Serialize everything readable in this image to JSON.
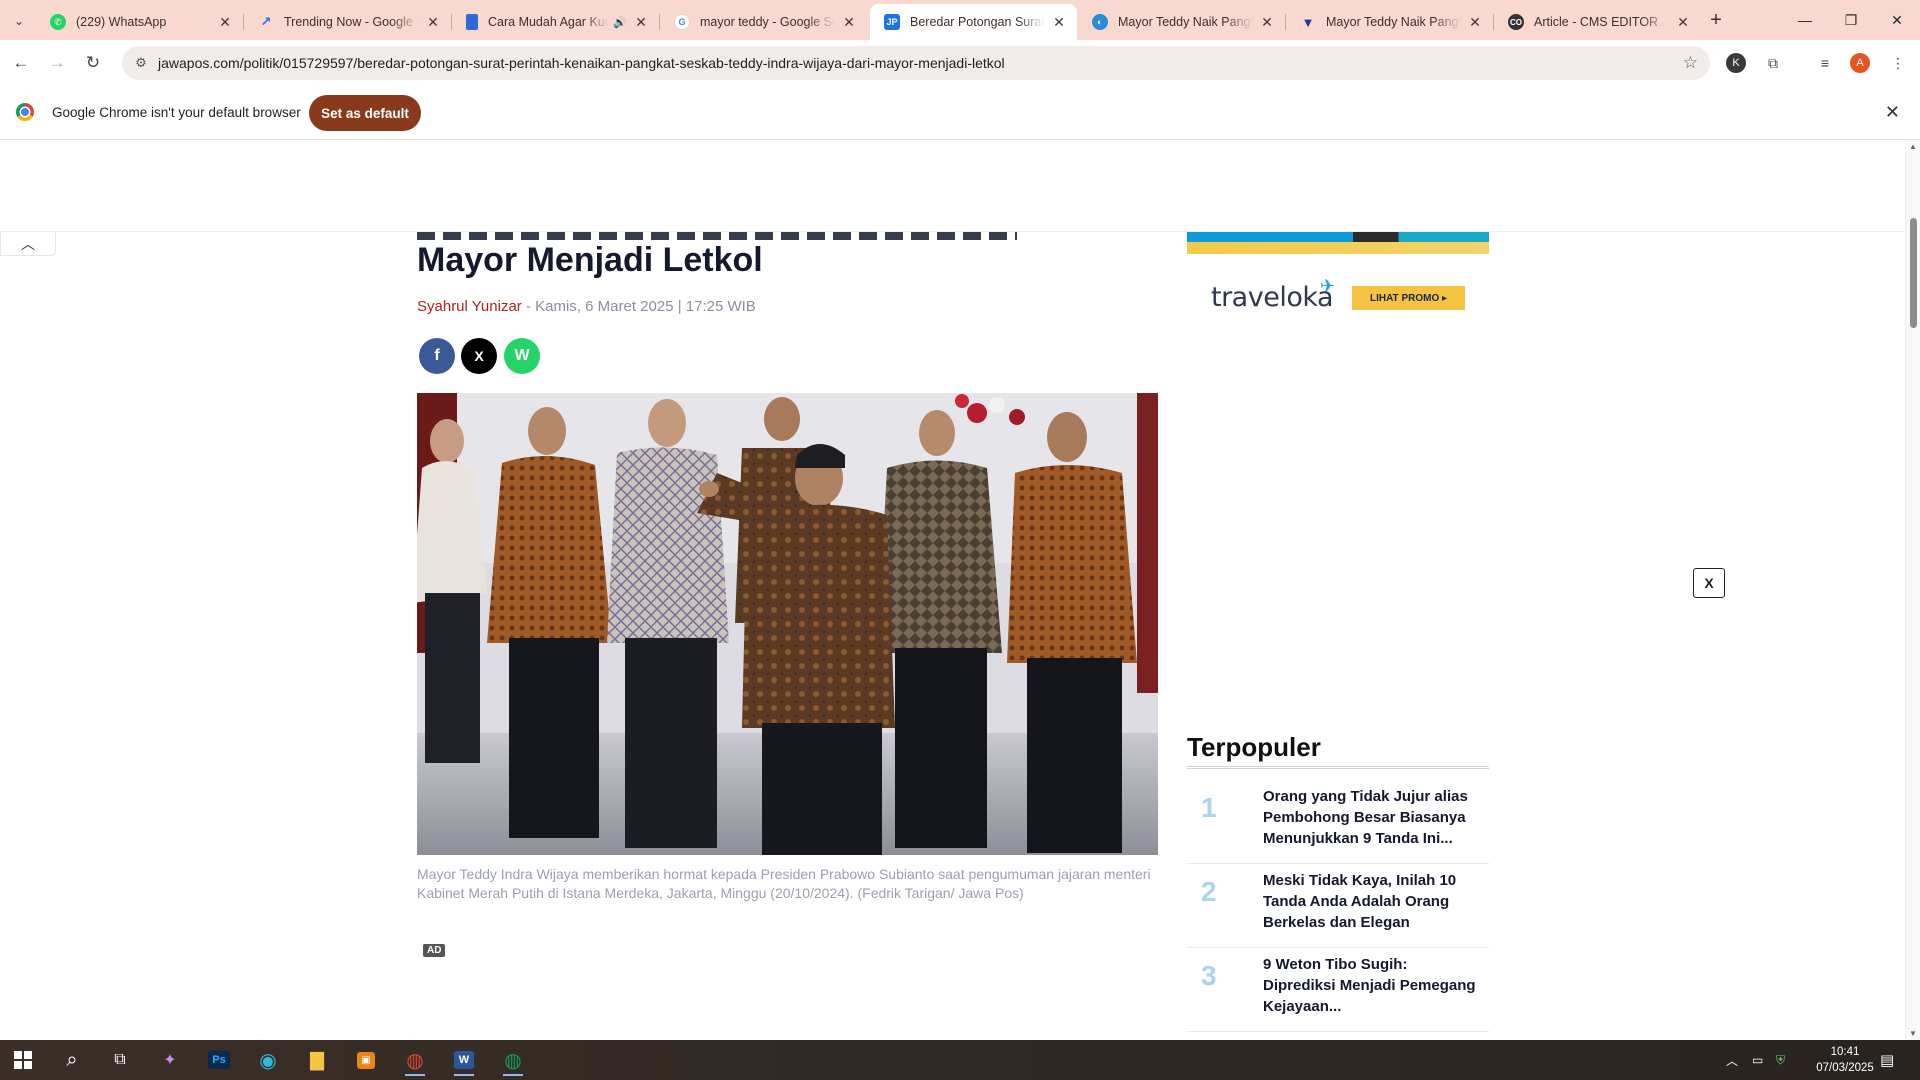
{
  "browser": {
    "tabs": [
      {
        "title": "(229) WhatsApp",
        "icon": "whatsapp-icon",
        "color": "#25d366"
      },
      {
        "title": "Trending Now - Google Trends",
        "icon": "trends-icon",
        "color": "#4285f4"
      },
      {
        "title": "Cara Mudah Agar Kucing",
        "icon": "page-icon",
        "color": "#2f6bd6"
      },
      {
        "title": "mayor teddy - Google Search",
        "icon": "google-icon",
        "color": "#4285f4"
      },
      {
        "title": "Beredar Potongan Surat Perintah",
        "icon": "jawapos-icon",
        "color": "#1a73e8"
      },
      {
        "title": "Mayor Teddy Naik Pangkat",
        "icon": "site-icon",
        "color": "#2a8bd8"
      },
      {
        "title": "Mayor Teddy Naik Pangkat",
        "icon": "site-icon-2",
        "color": "#1a3d8f"
      },
      {
        "title": "Article - CMS EDITOR",
        "icon": "cms-icon",
        "color": "#333333"
      }
    ],
    "url": "jawapos.com/politik/015729597/beredar-potongan-surat-perintah-kenaikan-pangkat-seskab-teddy-indra-wijaya-dari-mayor-menjadi-letkol",
    "infobar": {
      "message": "Google Chrome isn't your default browser",
      "button": "Set as default"
    }
  },
  "article": {
    "headline": "Mayor Menjadi Letkol",
    "author": "Syahrul Yunizar",
    "date": " - Kamis, 6 Maret 2025 | 17:25 WIB",
    "share": {
      "facebook": "f",
      "x": "X",
      "whatsapp": "W"
    },
    "caption": "Mayor Teddy Indra Wijaya memberikan hormat kepada Presiden Prabowo Subianto saat pengumuman jajaran menteri Kabinet Merah Putih di Istana Merdeka, Jakarta, Minggu (20/10/2024). (Fedrik Tarigan/ Jawa Pos)",
    "ad_label": "AD"
  },
  "sidebar": {
    "ad": {
      "brand": "traveloka",
      "promo": "LIHAT PROMO ▸",
      "close": "X"
    },
    "popular_title": "Terpopuler",
    "popular": [
      {
        "rank": "1",
        "title": "Orang yang Tidak Jujur alias Pembohong Besar Biasanya Menunjukkan 9 Tanda Ini..."
      },
      {
        "rank": "2",
        "title": "Meski Tidak Kaya, Inilah 10 Tanda Anda Adalah Orang Berkelas dan Elegan"
      },
      {
        "rank": "3",
        "title": "9 Weton Tibo Sugih: Diprediksi Menjadi Pemegang Kejayaan..."
      }
    ]
  },
  "taskbar": {
    "time": "10:41",
    "date": "07/03/2025"
  },
  "colors": {
    "tabstrip": "#f9d8cf",
    "author": "#b21d1d",
    "set_default_button": "#8a3a1c",
    "rank_number": "#a9d3f0"
  }
}
